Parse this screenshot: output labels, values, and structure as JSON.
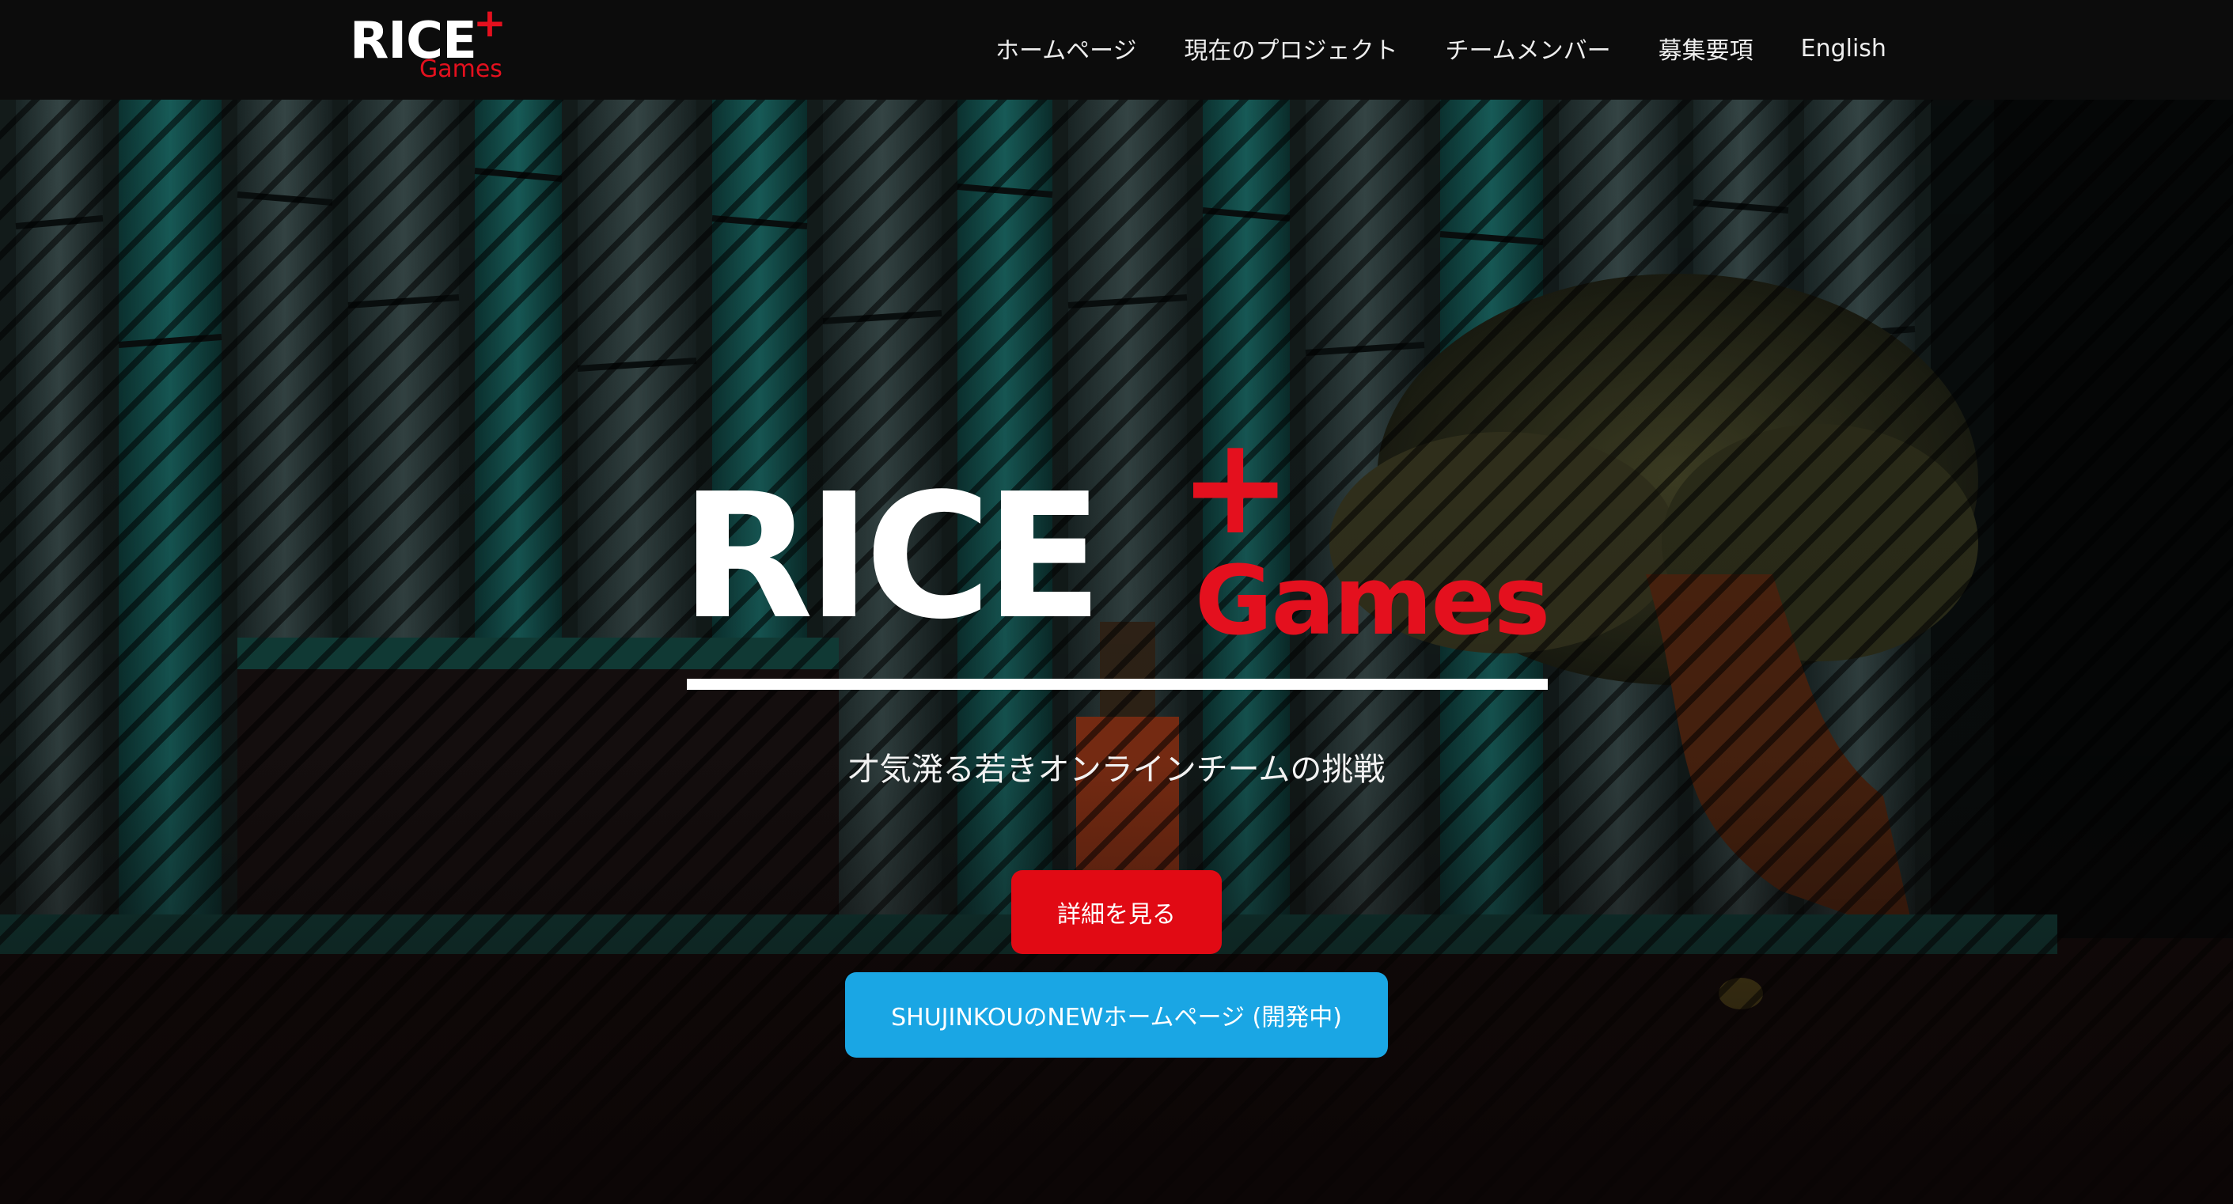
{
  "brand": {
    "rice": "RICE",
    "plus": "+",
    "games": "Games"
  },
  "nav": {
    "items": [
      {
        "label": "ホームページ"
      },
      {
        "label": "現在のプロジェクト"
      },
      {
        "label": "チームメンバー"
      },
      {
        "label": "募集要項"
      },
      {
        "label": "English"
      }
    ]
  },
  "hero": {
    "logo_rice": "RICE",
    "logo_plus": "+",
    "logo_games": "Games",
    "tagline": "才気溌る若きオンラインチームの挑戦",
    "detail_button": "詳細を見る",
    "new_homepage_button": "SHUJINKOUのNEWホームページ (開発中)"
  },
  "colors": {
    "brand_red": "#e4101e",
    "button_red": "#e10a14",
    "button_blue": "#1aa6e4",
    "navbar_bg": "#0c0c0c"
  }
}
